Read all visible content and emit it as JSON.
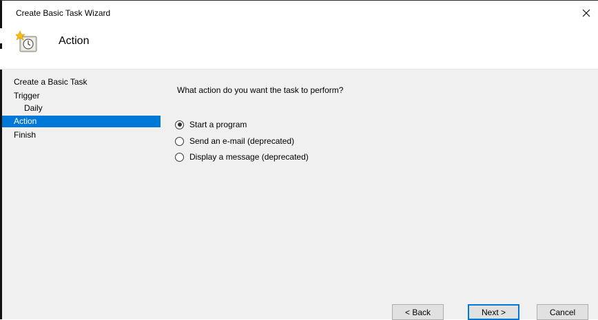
{
  "window": {
    "title": "Create Basic Task Wizard",
    "close_icon": "close-icon"
  },
  "header": {
    "icon": "scheduled-task-clock-icon",
    "title": "Action"
  },
  "nav": {
    "items": [
      {
        "label": "Create a Basic Task",
        "selected": false
      },
      {
        "label": "Trigger",
        "selected": false
      },
      {
        "label": "Daily",
        "selected": false
      },
      {
        "label": "Action",
        "selected": true
      },
      {
        "label": "Finish",
        "selected": false
      }
    ]
  },
  "main": {
    "question": "What action do you want the task to perform?",
    "options": [
      {
        "label": "Start a program",
        "checked": true
      },
      {
        "label": "Send an e-mail (deprecated)",
        "checked": false
      },
      {
        "label": "Display a message (deprecated)",
        "checked": false
      }
    ]
  },
  "buttons": {
    "back": "< Back",
    "next": "Next >",
    "cancel": "Cancel"
  },
  "colors": {
    "selection": "#0078d7",
    "content_background": "#f0f0f0",
    "button_face": "#e1e1e1"
  }
}
